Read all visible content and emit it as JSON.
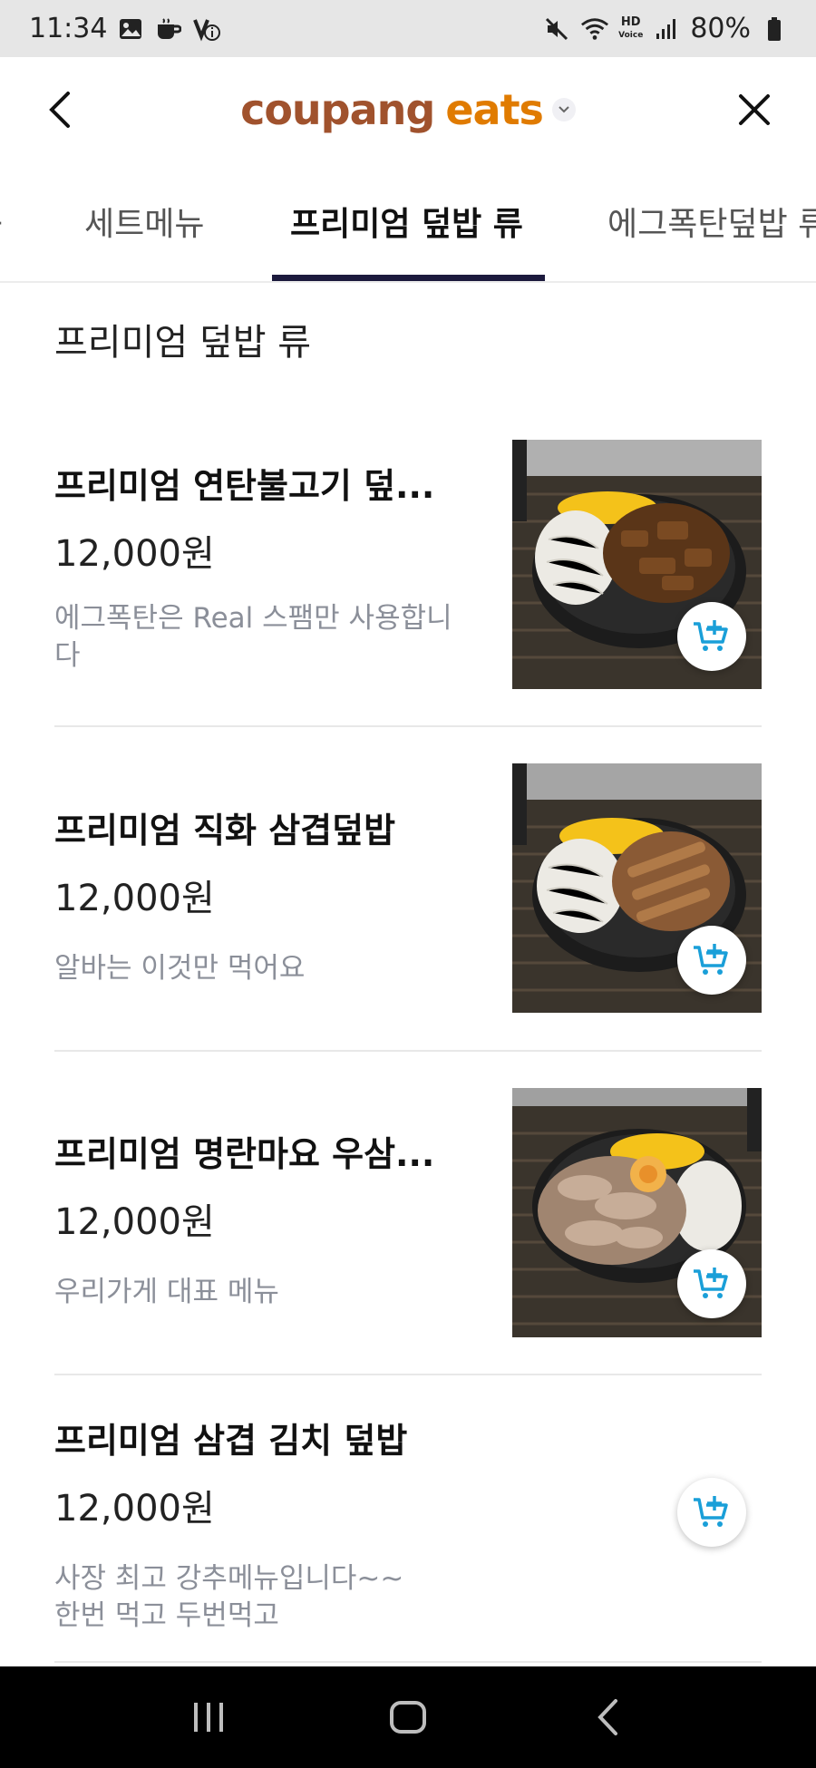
{
  "status_bar": {
    "time": "11:34",
    "battery": "80%",
    "hd_line1": "HD",
    "hd_line2": "Voice"
  },
  "header": {
    "logo_part1": "coupang",
    "logo_part2": "eats",
    "back_icon": "chevron-left-icon",
    "close_icon": "close-icon"
  },
  "tabs": [
    {
      "label": "세트메뉴",
      "active": false
    },
    {
      "label": "프리미엄 덮밥 류",
      "active": true
    },
    {
      "label": "에그폭탄덮밥 류",
      "active": false
    }
  ],
  "section": {
    "title": "프리미엄 덮밥 류"
  },
  "items": [
    {
      "name": "프리미엄 연탄불고기 덮...",
      "price": "12,000원",
      "desc_line1": "에그폭탄은 Real 스팸만 사용합니",
      "desc_line2": "다",
      "has_image": true
    },
    {
      "name": "프리미엄 직화 삼겹덮밥",
      "price": "12,000원",
      "desc_line1": "알바는 이것만 먹어요",
      "desc_line2": "",
      "has_image": true
    },
    {
      "name": "프리미엄 명란마요 우삼...",
      "price": "12,000원",
      "desc_line1": "우리가게 대표 메뉴",
      "desc_line2": "",
      "has_image": true
    },
    {
      "name": "프리미엄 삼겹 김치 덮밥",
      "price": "12,000원",
      "desc_line1": "사장 최고 강추메뉴입니다~~",
      "desc_line2": "한번 먹고 두번먹고",
      "has_image": false
    }
  ],
  "colors": {
    "brand_brown": "#a0522d",
    "brand_orange": "#e07b00",
    "tab_underline": "#1c1a3d",
    "cart_icon": "#1a9fd8",
    "desc_gray": "#8b8f99"
  }
}
